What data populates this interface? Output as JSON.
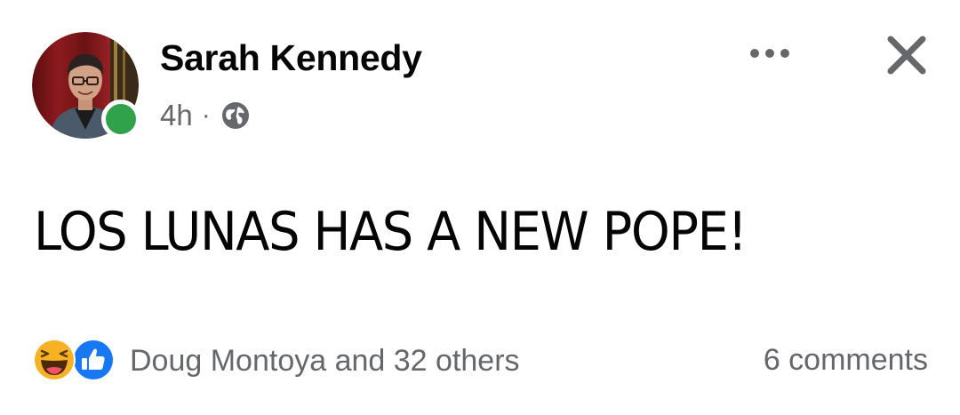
{
  "post": {
    "author": "Sarah Kennedy",
    "time": "4h",
    "separator": "·",
    "privacy_icon": "globe-icon",
    "online": true,
    "text": "LOS LUNAS HAS A NEW POPE!",
    "reactions": {
      "icons": [
        "haha-icon",
        "like-icon"
      ],
      "summary": "Doug Montoya and 32 others"
    },
    "comments": "6 comments"
  },
  "colors": {
    "name": "#050505",
    "secondary": "#65676b",
    "online": "#31a24c",
    "like_blue": "#1877f2",
    "haha_yellow": "#f7b125"
  }
}
